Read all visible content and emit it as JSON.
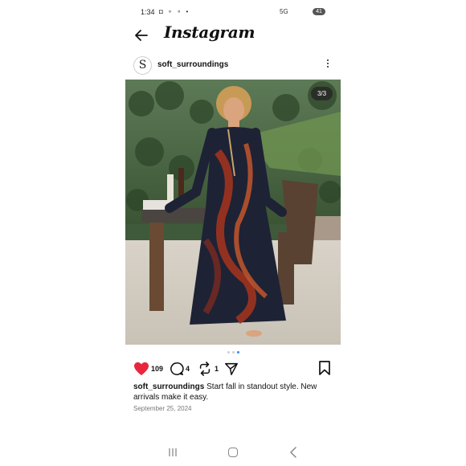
{
  "status_bar": {
    "time": "1:34",
    "left_icons": "◘ ∘ ∘ •",
    "network": "5G",
    "battery": "41"
  },
  "header": {
    "app_title": "Instagram",
    "back_icon": "arrow-left-icon"
  },
  "post": {
    "avatar_letter": "S",
    "username": "soft_surroundings",
    "image_counter": "3/3",
    "likes": "109",
    "comments": "4",
    "reposts": "1",
    "caption_user": "soft_surroundings",
    "caption_text": " Start fall in standout style. New arrivals make it easy.",
    "date": "September 25, 2024",
    "carousel_total": 3,
    "carousel_active": 3
  },
  "colors": {
    "heart": "#e8273d",
    "active_dot": "#3d83f6"
  }
}
